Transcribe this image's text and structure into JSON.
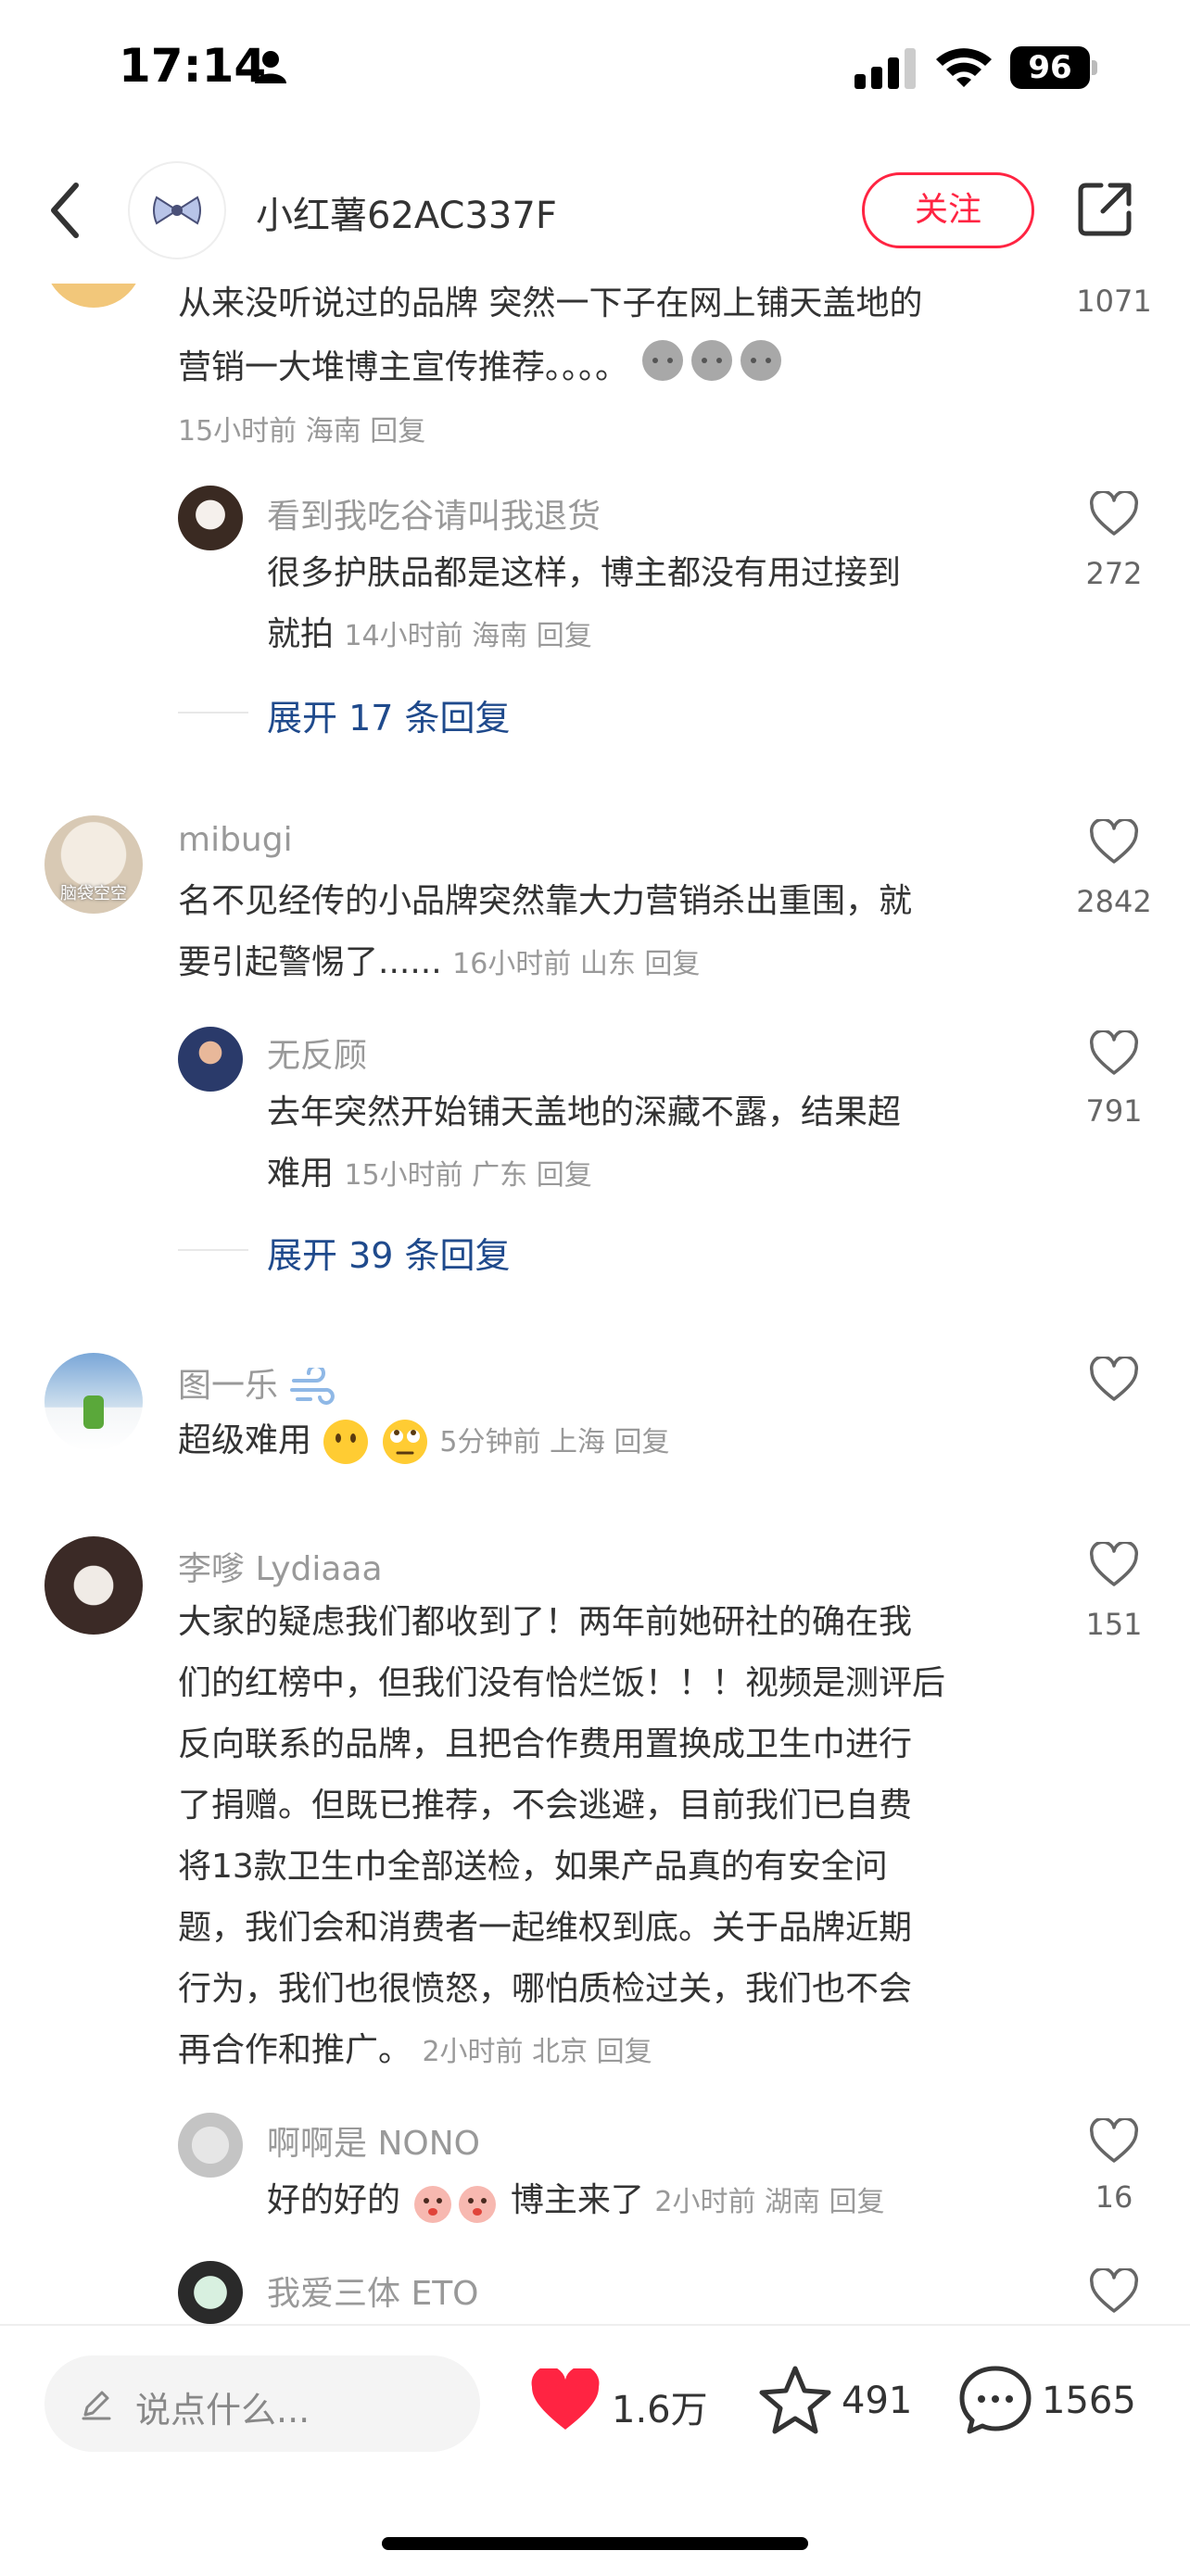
{
  "status_bar": {
    "time": "17:14",
    "battery": "96"
  },
  "header": {
    "username": "小红薯62AC337F",
    "follow_label": "关注"
  },
  "comments": [
    {
      "text_line1": "从来没听说过的品牌 突然一下子在网上铺天盖地的",
      "text_line2": "营销一大堆博主宣传推荐。。。。",
      "meta": "15小时前 海南 回复",
      "likes": "1071",
      "reply": {
        "name": "看到我吃谷请叫我退货",
        "text_line1": "很多护肤品都是这样，博主都没有用过接到",
        "text_line2": "就拍",
        "meta": "14小时前 海南 回复",
        "likes": "272"
      },
      "expand": "展开 17 条回复"
    },
    {
      "name": "mibugi",
      "avatar_caption": "脑袋空空",
      "text_line1": "名不见经传的小品牌突然靠大力营销杀出重围，就",
      "text_line2": "要引起警惕了......",
      "meta": "16小时前 山东 回复",
      "likes": "2842",
      "reply": {
        "name": "无反顾",
        "text_line1": "去年突然开始铺天盖地的深藏不露，结果超",
        "text_line2": "难用",
        "meta": "15小时前 广东 回复",
        "likes": "791"
      },
      "expand": "展开 39 条回复"
    },
    {
      "name": "图一乐",
      "text": "超级难用",
      "meta": "5分钟前 上海 回复",
      "likes": ""
    },
    {
      "name": "李嗲 Lydiaaa",
      "lines": [
        "大家的疑虑我们都收到了！两年前她研社的确在我",
        "们的红榜中，但我们没有恰烂饭！！！视频是测评后",
        "反向联系的品牌，且把合作费用置换成卫生巾进行",
        "了捐赠。但既已推荐，不会逃避，目前我们已自费",
        "将13款卫生巾全部送检，如果产品真的有安全问",
        "题，我们会和消费者一起维权到底。关于品牌近期",
        "行为，我们也很愤怒，哪怕质检过关，我们也不会",
        "再合作和推广。"
      ],
      "meta": "2小时前 北京 回复",
      "likes": "151",
      "reply": {
        "name": "啊啊是 NONO",
        "text_pre": "好的好的",
        "text_post": "博主来了",
        "meta": "2小时前 湖南 回复",
        "likes": "16"
      }
    },
    {
      "name": "我爱三体 ETO"
    }
  ],
  "bottom_bar": {
    "input_placeholder": "说点什么...",
    "likes": "1.6万",
    "stars": "491",
    "comments": "1565"
  },
  "colors": {
    "accent": "#ff2442",
    "link": "#1f4a8c",
    "meta": "#999999"
  }
}
